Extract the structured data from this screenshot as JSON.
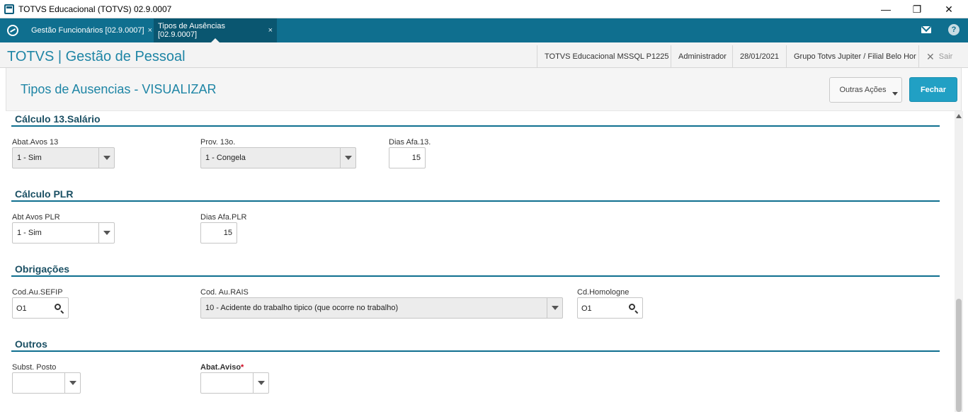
{
  "window": {
    "title": "TOTVS Educacional (TOTVS) 02.9.0007",
    "minimize_label": "—",
    "restore_label": "❐",
    "close_label": "✕"
  },
  "tabs": [
    {
      "label": "Gestão Funcionários [02.9.0007]",
      "close": "×"
    },
    {
      "label": "Tipos de Ausências [02.9.0007]",
      "close": "×"
    }
  ],
  "topbar_icons": [
    "mail-icon",
    "help-icon"
  ],
  "help_label": "?",
  "brand": {
    "title": "TOTVS | Gestão de Pessoal",
    "database": "TOTVS Educacional MSSQL P1225",
    "user": "Administrador",
    "date": "28/01/2021",
    "company": "Grupo Totvs Jupiter / Filial Belo Hor",
    "exit_label": "Sair"
  },
  "page": {
    "title": "Tipos de Ausencias - VISUALIZAR",
    "other_actions_label": "Outras Ações",
    "close_button_label": "Fechar"
  },
  "sections": {
    "calc13": {
      "title": "Cálculo 13.Salário",
      "abat_label": "Abat.Avos 13",
      "abat_value": "1 - Sim",
      "prov_label": "Prov. 13o.",
      "prov_value": "1 - Congela",
      "dias_label": "Dias Afa.13.",
      "dias_value": "15"
    },
    "plr": {
      "title": "Cálculo PLR",
      "abt_label": "Abt Avos PLR",
      "abt_value": "1 - Sim",
      "dias_label": "Dias Afa.PLR",
      "dias_value": "15"
    },
    "obrigacoes": {
      "title": "Obrigações",
      "sefip_label": "Cod.Au.SEFIP",
      "sefip_value": "O1",
      "rais_label": "Cod. Au.RAIS",
      "rais_value": "10 - Acidente do trabalho tipico (que ocorre no trabalho)",
      "homolog_label": "Cd.Homologne",
      "homolog_value": "O1"
    },
    "outros": {
      "title": "Outros",
      "subst_label": "Subst. Posto",
      "subst_value": "",
      "aviso_label": "Abat.Aviso",
      "aviso_required": "*",
      "aviso_value": ""
    }
  },
  "colors": {
    "accent": "#0f6f8f",
    "button_primary": "#21a0c4",
    "highlight": "#ffff00"
  }
}
